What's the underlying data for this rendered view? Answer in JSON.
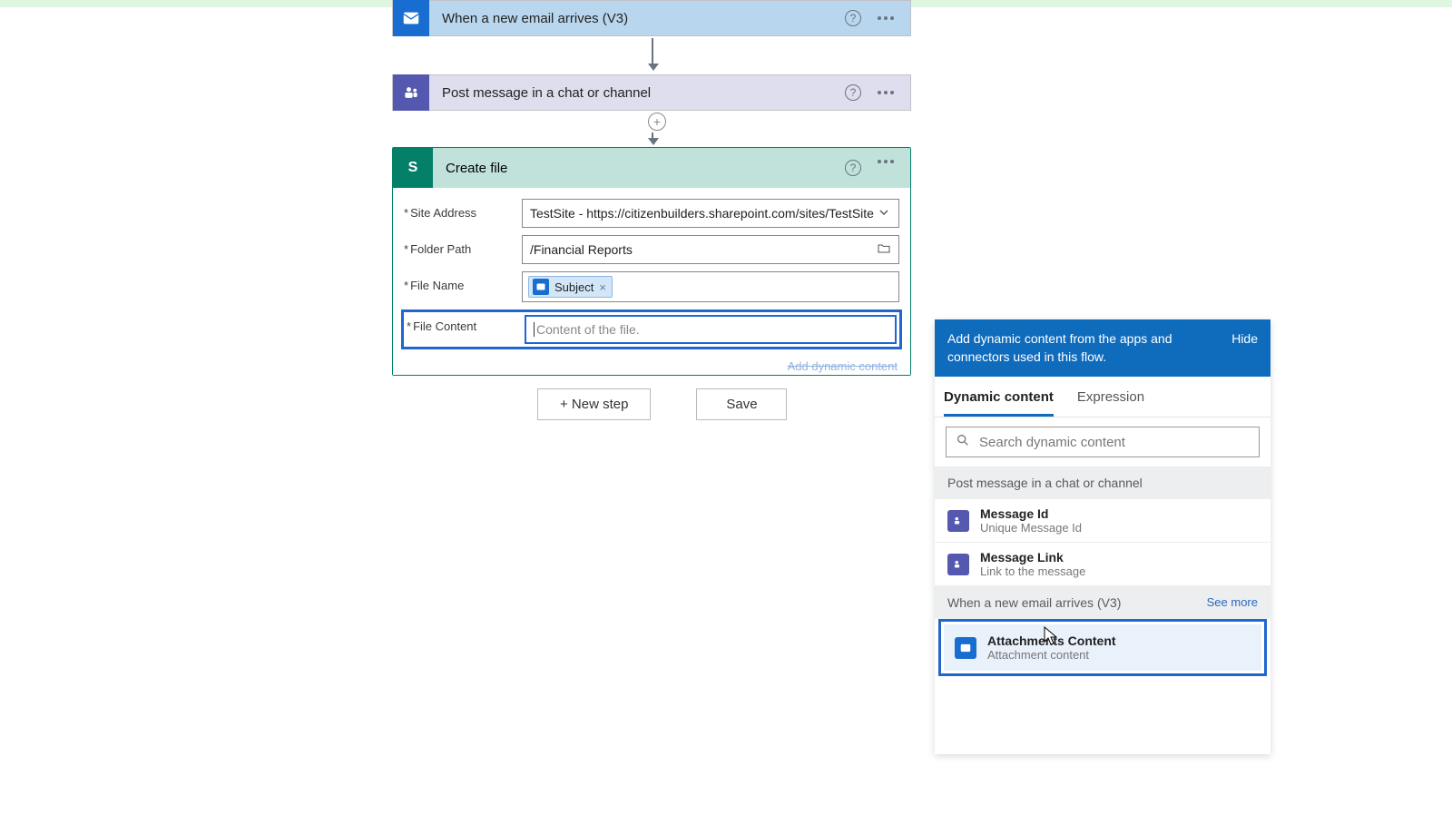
{
  "colors": {
    "accent_blue": "#1f66d1",
    "panel_blue": "#0f6cbd",
    "sharepoint_green": "#048068",
    "teams_purple": "#5558af",
    "outlook_blue": "#1a6dd0"
  },
  "flow": {
    "trigger": {
      "title": "When a new email arrives (V3)"
    },
    "action1": {
      "title": "Post message in a chat or channel"
    },
    "create_file": {
      "title": "Create file",
      "fields": {
        "site_address": {
          "label": "Site Address",
          "value": "TestSite - https://citizenbuilders.sharepoint.com/sites/TestSite"
        },
        "folder_path": {
          "label": "Folder Path",
          "value": "/Financial Reports"
        },
        "file_name": {
          "label": "File Name",
          "pill": "Subject"
        },
        "file_content": {
          "label": "File Content",
          "placeholder": "Content of the file."
        }
      },
      "add_dynamic_link": "Add dynamic content"
    },
    "buttons": {
      "new_step": "+ New step",
      "save": "Save"
    }
  },
  "dynamic_content": {
    "header": "Add dynamic content from the apps and connectors used in this flow.",
    "hide": "Hide",
    "tabs": {
      "dynamic": "Dynamic content",
      "expression": "Expression"
    },
    "search_placeholder": "Search dynamic content",
    "groups": [
      {
        "title": "Post message in a chat or channel",
        "see_more": "",
        "items": [
          {
            "icon": "teams",
            "title": "Message Id",
            "subtitle": "Unique Message Id"
          },
          {
            "icon": "teams",
            "title": "Message Link",
            "subtitle": "Link to the message"
          }
        ]
      },
      {
        "title": "When a new email arrives (V3)",
        "see_more": "See more",
        "items": [
          {
            "icon": "outlook",
            "title": "Attachments Content",
            "subtitle": "Attachment content",
            "highlight": true
          }
        ]
      }
    ]
  }
}
